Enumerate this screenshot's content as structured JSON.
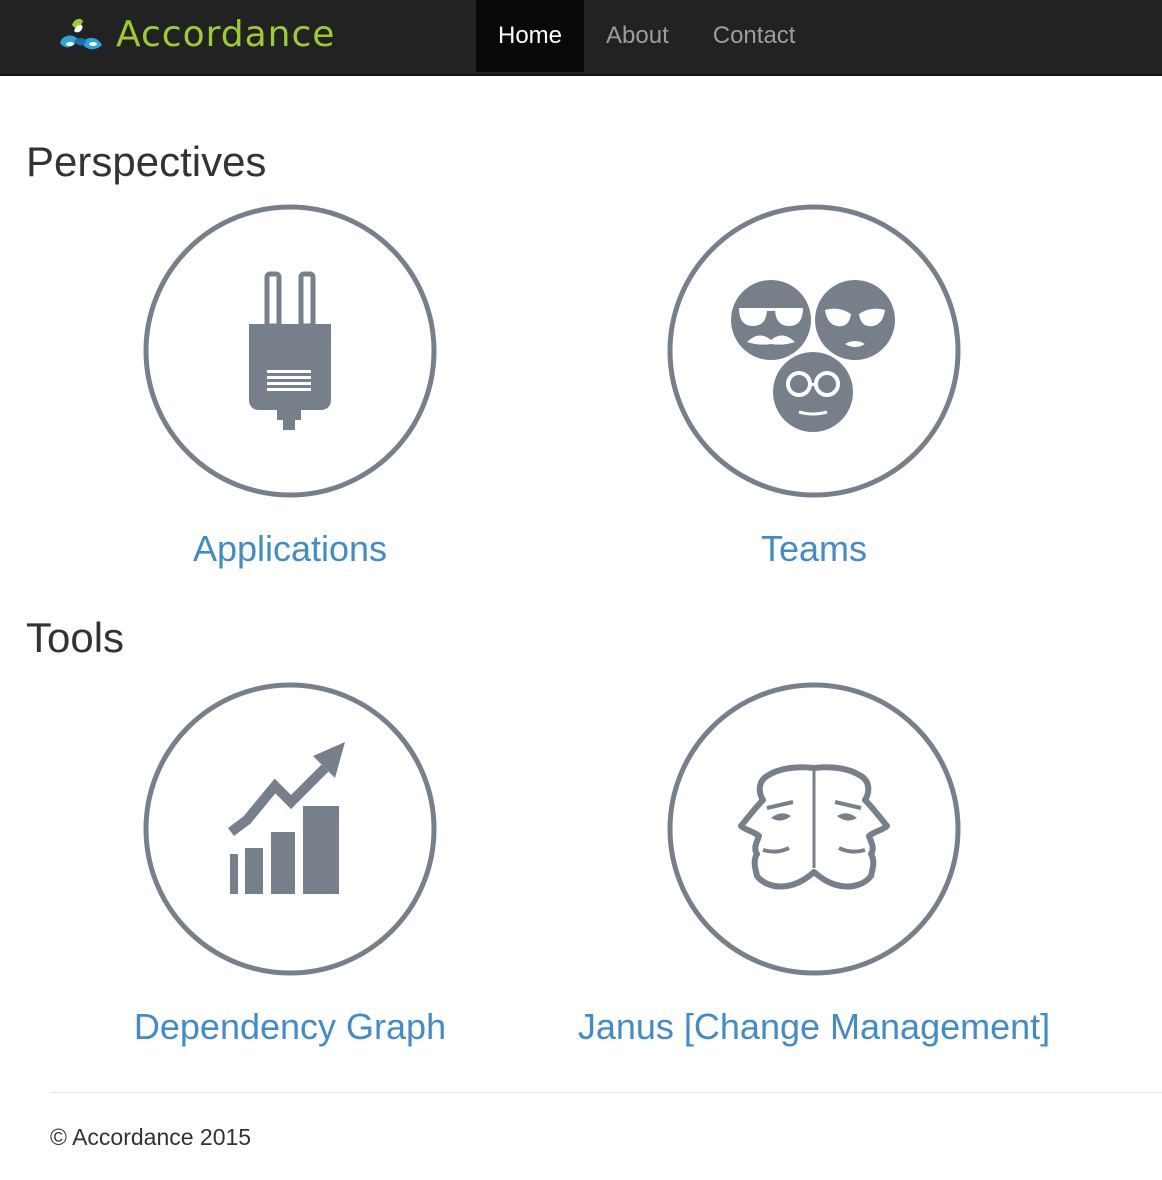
{
  "brand": {
    "name": "Accordance",
    "logo_icon": "accordance-logo-icon",
    "color": "#9ccc2e"
  },
  "nav": {
    "items": [
      {
        "label": "Home",
        "active": true
      },
      {
        "label": "About",
        "active": false
      },
      {
        "label": "Contact",
        "active": false
      }
    ]
  },
  "sections": {
    "perspectives": {
      "title": "Perspectives",
      "tiles": [
        {
          "label": "Applications",
          "icon": "plug-icon"
        },
        {
          "label": "Teams",
          "icon": "teams-faces-icon"
        }
      ]
    },
    "tools": {
      "title": "Tools",
      "tiles": [
        {
          "label": "Dependency Graph",
          "icon": "growth-chart-icon"
        },
        {
          "label": "Janus [Change Management]",
          "icon": "janus-faces-icon"
        }
      ]
    }
  },
  "footer": {
    "text": "© Accordance 2015"
  },
  "colors": {
    "navbar": "#222222",
    "link": "#428bca",
    "icon": "#77808a",
    "brand": "#9ccc2e"
  }
}
